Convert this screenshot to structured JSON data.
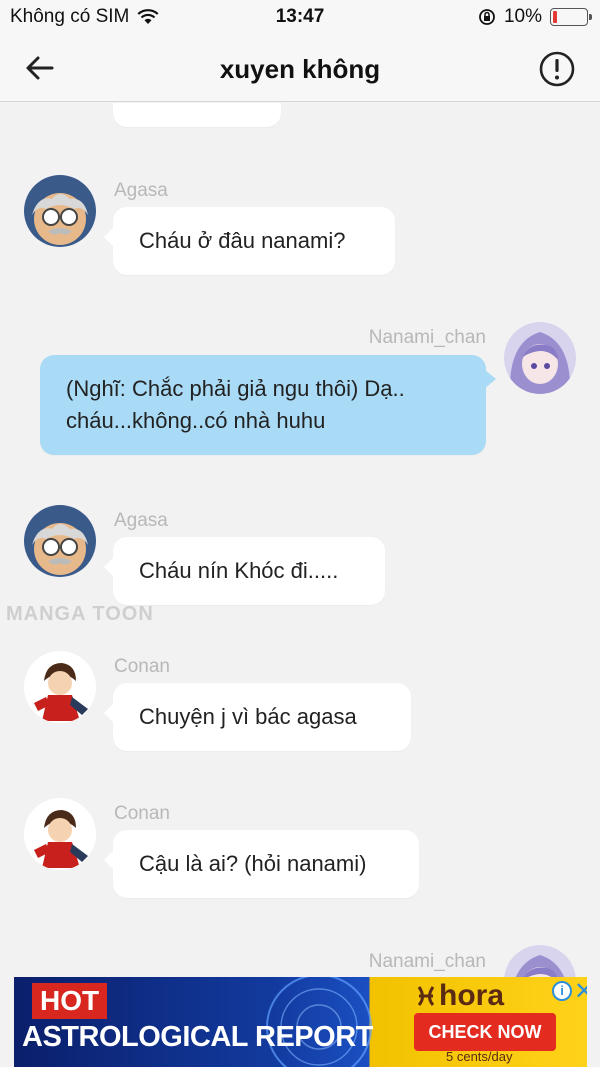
{
  "status_bar": {
    "carrier": "Không có SIM",
    "time": "13:47",
    "battery": "10%"
  },
  "header": {
    "title": "xuyen không",
    "back_icon": "back-arrow-icon",
    "info_icon": "alert-circle-icon"
  },
  "messages": [
    {
      "sender": "Agasa",
      "text": "Cháu ở đâu nanami?",
      "side": "left"
    },
    {
      "sender": "Nanami_chan",
      "text": "(Nghĩ: Chắc phải giả ngu thôi) Dạ.. cháu...không..có nhà huhu",
      "side": "right"
    },
    {
      "sender": "Agasa",
      "text": "Cháu nín Khóc đi.....",
      "side": "left"
    },
    {
      "sender": "Conan",
      "text": "Chuyện j vì bác agasa",
      "side": "left"
    },
    {
      "sender": "Conan",
      "text": "Cậu là ai? (hỏi nanami)",
      "side": "left"
    },
    {
      "sender": "Nanami_chan",
      "text": "",
      "side": "right"
    }
  ],
  "watermark": "MANGA TOON",
  "ad": {
    "hot": "HOT",
    "headline": "ASTROLOGICAL REPORT",
    "brand": "hora",
    "cta": "CHECK NOW",
    "price": "5 cents/day",
    "info": "i",
    "close": "✕"
  },
  "colors": {
    "my_bubble": "#a9dbf6",
    "their_bubble": "#ffffff",
    "background": "#f2f2f2",
    "battery_low": "#e53935"
  }
}
